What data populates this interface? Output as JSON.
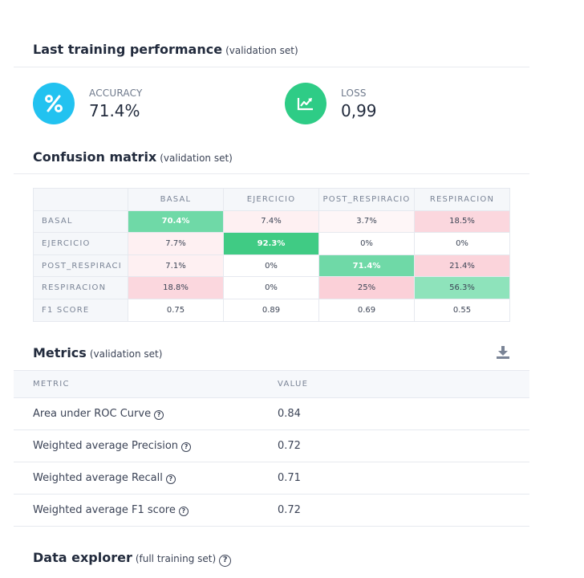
{
  "performance": {
    "title": "Last training performance",
    "subtitle": "(validation set)",
    "accuracy": {
      "label": "ACCURACY",
      "value": "71.4%",
      "icon": "percent-icon",
      "color": "#22c2f0"
    },
    "loss": {
      "label": "LOSS",
      "value": "0,99",
      "icon": "chart-line-icon",
      "color": "#2ecc86"
    }
  },
  "confusion": {
    "title": "Confusion matrix",
    "subtitle": "(validation set)",
    "columns": [
      "BASAL",
      "EJERCICIO",
      "POST_RESPIRACIO",
      "RESPIRACION"
    ],
    "rows": [
      {
        "label": "BASAL",
        "cells": [
          "70.4%",
          "7.4%",
          "3.7%",
          "18.5%"
        ]
      },
      {
        "label": "EJERCICIO",
        "cells": [
          "7.7%",
          "92.3%",
          "0%",
          "0%"
        ]
      },
      {
        "label": "POST_RESPIRACI",
        "cells": [
          "7.1%",
          "0%",
          "71.4%",
          "21.4%"
        ]
      },
      {
        "label": "RESPIRACION",
        "cells": [
          "18.8%",
          "0%",
          "25%",
          "56.3%"
        ]
      }
    ],
    "f1": {
      "label": "F1 SCORE",
      "cells": [
        "0.75",
        "0.89",
        "0.69",
        "0.55"
      ]
    }
  },
  "metrics": {
    "title": "Metrics",
    "subtitle": "(validation set)",
    "download_icon": "download-icon",
    "col_metric": "METRIC",
    "col_value": "VALUE",
    "rows": [
      {
        "name": "Area under ROC Curve",
        "value": "0.84"
      },
      {
        "name": "Weighted average Precision",
        "value": "0.72"
      },
      {
        "name": "Weighted average Recall",
        "value": "0.71"
      },
      {
        "name": "Weighted average F1 score",
        "value": "0.72"
      }
    ]
  },
  "explorer": {
    "title": "Data explorer",
    "subtitle": "(full training set)"
  }
}
